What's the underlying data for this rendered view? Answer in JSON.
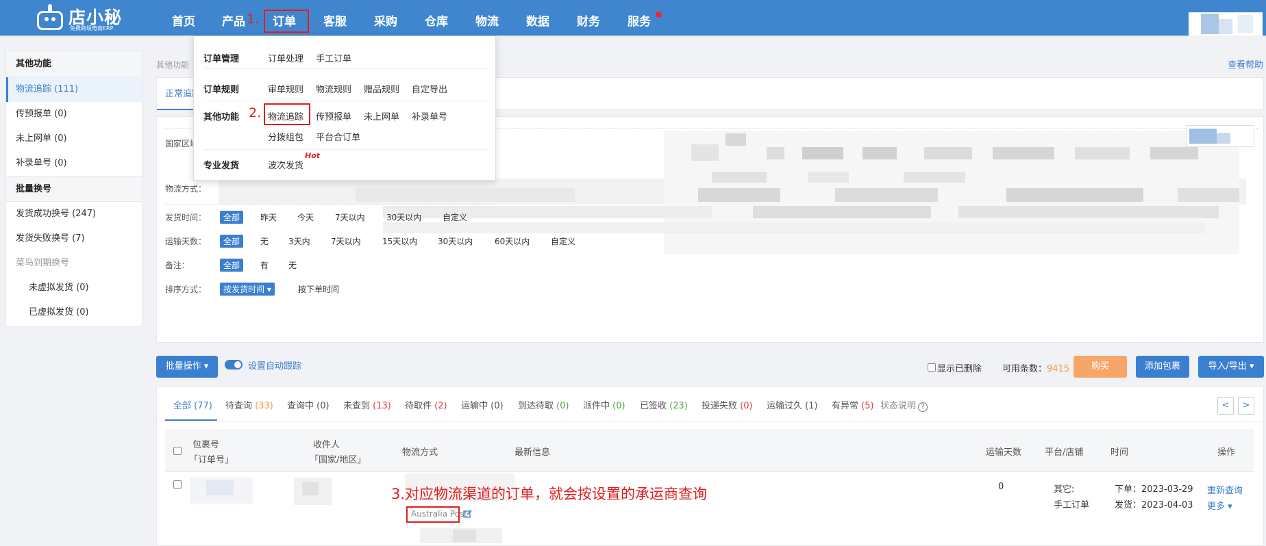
{
  "brand": {
    "name": "店小秘",
    "tagline": "免费跨境电商ERP"
  },
  "nav": {
    "items": [
      "首页",
      "产品",
      "订单",
      "客服",
      "采购",
      "仓库",
      "物流",
      "数据",
      "财务",
      "服务"
    ]
  },
  "steps": {
    "s1": "1.",
    "s2": "2.",
    "s3": "3.对应物流渠道的订单，就会按设置的承运商查询"
  },
  "dropdown": {
    "group1": {
      "label": "订单管理",
      "links": [
        "订单处理",
        "手工订单"
      ]
    },
    "group2": {
      "label": "订单规则",
      "links": [
        "审单规则",
        "物流规则",
        "赠品规则",
        "自定导出"
      ]
    },
    "group3": {
      "label": "其他功能",
      "links": [
        "物流追踪",
        "传预报单",
        "未上网单",
        "补录单号",
        "分拨组包",
        "平台合订单"
      ]
    },
    "group4": {
      "label": "专业发货",
      "links": [
        "波次发货"
      ],
      "badge": "Hot"
    }
  },
  "sidebar": {
    "section1": "其他功能",
    "items1": [
      "物流追踪 (111)",
      "传预报单 (0)",
      "未上网单 (0)",
      "补录单号 (0)"
    ],
    "section2": "批量换号",
    "items2": [
      "发货成功换号 (247)",
      "发货失败换号 (7)",
      "菜鸟到期换号",
      "未虚拟发货 (0)",
      "已虚拟发货 (0)"
    ]
  },
  "breadcrumb": "其他功能",
  "help_link": "查看帮助",
  "tab_normal": "正常追踪",
  "filters": {
    "country_label": "国家区域：",
    "logistics_label": "物流方式：",
    "ship_time": {
      "label": "发货时间：",
      "options": [
        "全部",
        "昨天",
        "今天",
        "7天以内",
        "30天以内",
        "自定义"
      ]
    },
    "transit_days": {
      "label": "运输天数：",
      "options": [
        "全部",
        "无",
        "3天内",
        "7天以内",
        "15天以内",
        "30天以内",
        "60天以内",
        "自定义"
      ]
    },
    "remark": {
      "label": "备注：",
      "options": [
        "全部",
        "有",
        "无"
      ]
    },
    "sort": {
      "label": "排序方式：",
      "selected": "按发货时间 ▾",
      "other": "按下单时间"
    }
  },
  "toolbar": {
    "batch": "批量操作 ▾",
    "auto_track": "设置自动跟踪",
    "show_deleted": "显示已删除",
    "quota_label": "可用条数：",
    "quota_value": "9415",
    "buy": "购买",
    "add_package": "添加包裹",
    "import_export": "导入/导出 ▾"
  },
  "status_tabs": {
    "t0": {
      "label": "全部",
      "count": "(77)"
    },
    "t1": {
      "label": "待查询",
      "count": "(33)"
    },
    "t2": {
      "label": "查询中",
      "count": "(0)"
    },
    "t3": {
      "label": "未查到",
      "count": "(13)"
    },
    "t4": {
      "label": "待取件",
      "count": "(2)"
    },
    "t5": {
      "label": "运输中",
      "count": "(0)"
    },
    "t6": {
      "label": "到达待取",
      "count": "(0)"
    },
    "t7": {
      "label": "派件中",
      "count": "(0)"
    },
    "t8": {
      "label": "已签收",
      "count": "(23)"
    },
    "t9": {
      "label": "投递失败",
      "count": "(0)"
    },
    "t10": {
      "label": "运输过久",
      "count": "(1)"
    },
    "t11": {
      "label": "有异常",
      "count": "(5)"
    },
    "t12": {
      "label": "状态说明",
      "count": ""
    }
  },
  "pager": {
    "prev": "<",
    "next": ">"
  },
  "table": {
    "headers": {
      "package": "包裹号",
      "order": "「订单号」",
      "recipient": "收件人",
      "country": "「国家/地区」",
      "logistics": "物流方式",
      "latest": "最新信息",
      "days": "运输天数",
      "platform": "平台/店铺",
      "time": "时间",
      "action": "操作"
    },
    "row": {
      "carrier": "Australia Post",
      "days": "0",
      "platform": "其它:",
      "store": "手工订单",
      "ordered": "下单：2023-03-29",
      "shipped": "发货：2023-04-03",
      "requery": "重新查询",
      "more": "更多 ▾"
    }
  },
  "colors": {
    "primary": "#3a7fd0",
    "topbar": "#3f86cf",
    "annotation": "#e11d1d",
    "warning": "#f7a66a"
  },
  "icons": [
    "robot-logo-icon",
    "notification-dot-icon",
    "edit-icon",
    "help-circle-icon",
    "checkbox-icon"
  ]
}
